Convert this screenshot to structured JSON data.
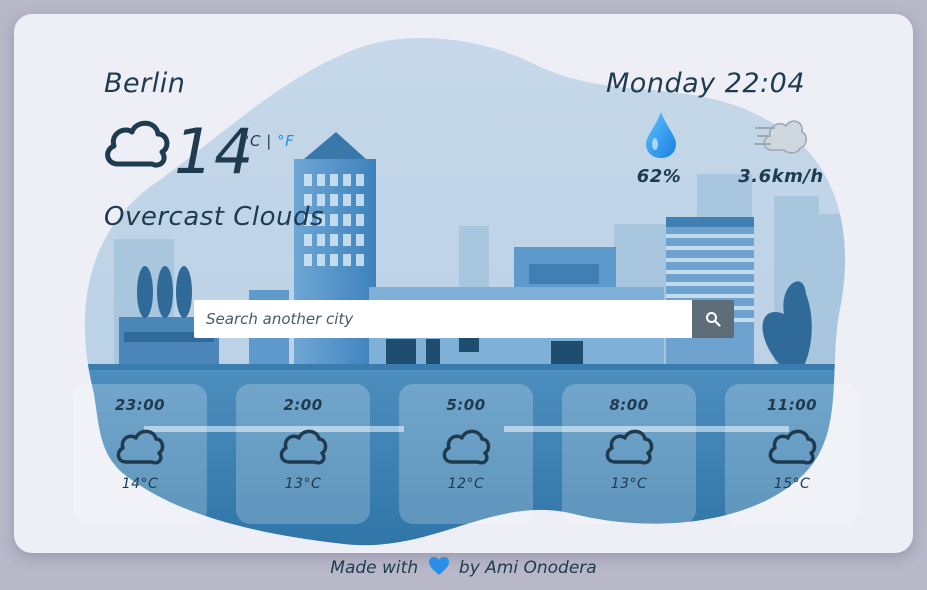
{
  "location": {
    "city": "Berlin",
    "datetime": "Monday 22:04"
  },
  "current": {
    "temperature": "14",
    "unit_celsius": "°C",
    "unit_separator": " | ",
    "unit_fahrenheit": "°F",
    "description": "Overcast Clouds",
    "icon": "cloud-icon"
  },
  "details": {
    "humidity": {
      "value": "62%",
      "icon": "water-drop-icon"
    },
    "wind": {
      "value": "3.6km/h",
      "icon": "wind-icon"
    }
  },
  "search": {
    "placeholder": "Search another city",
    "button_icon": "search-icon"
  },
  "forecast": [
    {
      "time": "23:00",
      "temp": "14°C",
      "icon": "cloud-icon"
    },
    {
      "time": "2:00",
      "temp": "13°C",
      "icon": "cloud-icon"
    },
    {
      "time": "5:00",
      "temp": "12°C",
      "icon": "cloud-icon"
    },
    {
      "time": "8:00",
      "temp": "13°C",
      "icon": "cloud-icon"
    },
    {
      "time": "11:00",
      "temp": "15°C",
      "icon": "cloud-icon"
    }
  ],
  "footer": {
    "prefix": "Made with",
    "suffix": "by Ami Onodera",
    "heart_color": "#2a8fe6"
  },
  "colors": {
    "text": "#1f3b4f",
    "accent": "#2a8fd6",
    "background": "#b9b8c9",
    "card": "#eeeff6"
  }
}
